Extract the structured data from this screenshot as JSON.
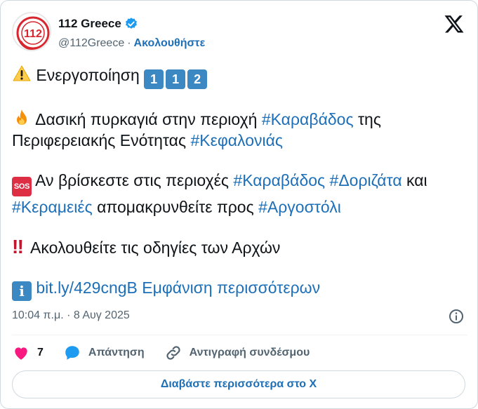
{
  "author": {
    "name": "112 Greece",
    "handle": "@112Greece",
    "separator": "·",
    "follow_label": "Ακολουθήστε",
    "avatar_text": "112"
  },
  "tweet": {
    "line1": {
      "emoji": "warning-icon",
      "text": "Ενεργοποίηση",
      "keycaps": [
        "1",
        "1",
        "2"
      ]
    },
    "line2": {
      "emoji": "fire-icon",
      "text_before": "Δασική πυρκαγιά στην περιοχή",
      "tag1": "#Καραβάδος",
      "text_mid": "της Περιφερειακής Ενότητας",
      "tag2": "#Κεφαλονιάς"
    },
    "line3": {
      "emoji": "SOS",
      "text_before": "Αν βρίσκεστε στις περιοχές",
      "tag1": "#Καραβάδος",
      "tag2": "#Δοριζάτα",
      "text_and": "και",
      "tag3": "#Κεραμειές",
      "text_mid": "απομακρυνθείτε προς",
      "tag4": "#Αργοστόλι"
    },
    "line4": {
      "emoji": "‼",
      "text": "Ακολουθείτε τις οδηγίες των Αρχών"
    },
    "line5": {
      "emoji": "i",
      "link": "bit.ly/429cngB",
      "show_more": "Εμφάνιση περισσότερων"
    }
  },
  "meta": {
    "timestamp": "10:04 π.μ. · 8 Αυγ 2025"
  },
  "actions": {
    "like_count": "7",
    "reply_label": "Απάντηση",
    "copy_link_label": "Αντιγραφή συνδέσμου"
  },
  "read_more_label": "Διαβάστε περισσότερα στο X",
  "colors": {
    "link": "#1d6fb8",
    "like": "#f91880",
    "reply": "#1d9bf0",
    "text": "#0f1419",
    "muted": "#536471"
  }
}
